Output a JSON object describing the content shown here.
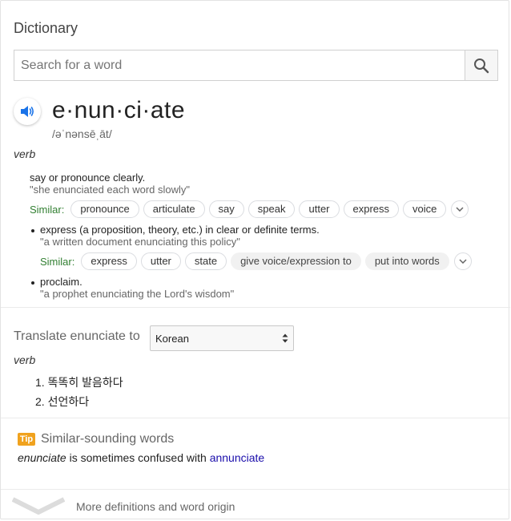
{
  "header": {
    "title": "Dictionary"
  },
  "search": {
    "placeholder": "Search for a word"
  },
  "entry": {
    "headword": "e·nun·ci·ate",
    "phonetic": "/əˈnənsēˌāt/",
    "pos": "verb",
    "senses": [
      {
        "definition": "say or pronounce clearly.",
        "example": "\"she enunciated each word slowly\"",
        "similar_label": "Similar:",
        "similar": [
          "pronounce",
          "articulate",
          "say",
          "speak",
          "utter",
          "express",
          "voice"
        ]
      },
      {
        "definition": "express (a proposition, theory, etc.) in clear or definite terms.",
        "example": "\"a written document enunciating this policy\"",
        "similar_label": "Similar:",
        "similar": [
          "express",
          "utter",
          "state",
          "give voice/expression to",
          "put into words"
        ]
      },
      {
        "definition": "proclaim.",
        "example": "\"a prophet enunciating the Lord's wisdom\""
      }
    ]
  },
  "translate": {
    "label": "Translate enunciate to",
    "language": "Korean",
    "pos": "verb",
    "items": [
      "1. 똑똑히 발음하다",
      "2. 선언하다"
    ]
  },
  "tip": {
    "badge": "Tip",
    "heading": "Similar-sounding words",
    "word": "enunciate",
    "middle": " is sometimes confused with ",
    "link": "annunciate"
  },
  "footer": {
    "more": "More definitions and word origin"
  },
  "colors": {
    "accent_blue": "#1a73e8",
    "similar_green": "#338033",
    "tip_orange": "#f0a21e",
    "link": "#1a0dab"
  }
}
